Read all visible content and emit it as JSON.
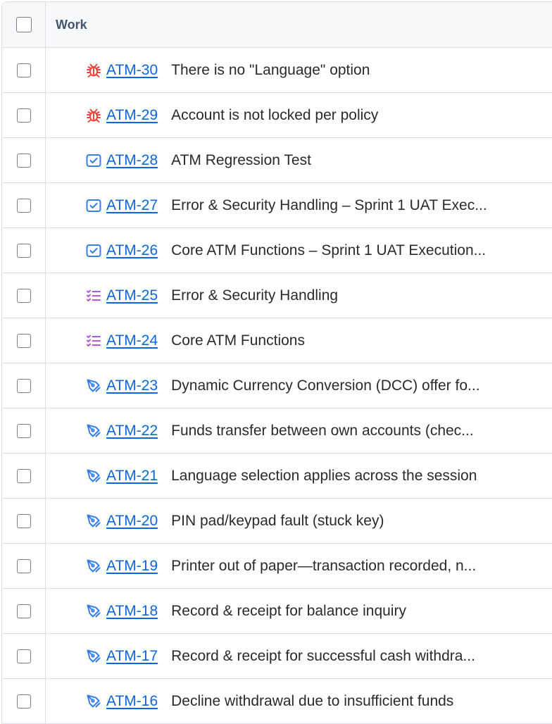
{
  "header": {
    "work_label": "Work"
  },
  "rows": [
    {
      "key": "ATM-30",
      "summary": "There is no \"Language\" option",
      "type": "bug",
      "icon": "bug-icon",
      "color": "#e2483d"
    },
    {
      "key": "ATM-29",
      "summary": "Account is not locked per policy",
      "type": "bug",
      "icon": "bug-icon",
      "color": "#e2483d"
    },
    {
      "key": "ATM-28",
      "summary": "ATM Regression Test",
      "type": "test-execution",
      "icon": "checkbox-icon",
      "color": "#357de8"
    },
    {
      "key": "ATM-27",
      "summary": "Error & Security Handling – Sprint 1 UAT Exec...",
      "type": "test-execution",
      "icon": "checkbox-icon",
      "color": "#357de8"
    },
    {
      "key": "ATM-26",
      "summary": "Core ATM Functions – Sprint 1 UAT Execution...",
      "type": "test-execution",
      "icon": "checkbox-icon",
      "color": "#357de8"
    },
    {
      "key": "ATM-25",
      "summary": "Error & Security Handling",
      "type": "test-plan",
      "icon": "checklist-icon",
      "color": "#af59e1"
    },
    {
      "key": "ATM-24",
      "summary": "Core ATM Functions",
      "type": "test-plan",
      "icon": "checklist-icon",
      "color": "#af59e1"
    },
    {
      "key": "ATM-23",
      "summary": "Dynamic Currency Conversion (DCC) offer fo...",
      "type": "test",
      "icon": "pen-tool-icon",
      "color": "#357de8"
    },
    {
      "key": "ATM-22",
      "summary": "Funds transfer between own accounts (chec...",
      "type": "test",
      "icon": "pen-tool-icon",
      "color": "#357de8"
    },
    {
      "key": "ATM-21",
      "summary": "Language selection applies across the session",
      "type": "test",
      "icon": "pen-tool-icon",
      "color": "#357de8"
    },
    {
      "key": "ATM-20",
      "summary": "PIN pad/keypad fault (stuck key)",
      "type": "test",
      "icon": "pen-tool-icon",
      "color": "#357de8"
    },
    {
      "key": "ATM-19",
      "summary": "Printer out of paper—transaction recorded, n...",
      "type": "test",
      "icon": "pen-tool-icon",
      "color": "#357de8"
    },
    {
      "key": "ATM-18",
      "summary": "Record & receipt for balance inquiry",
      "type": "test",
      "icon": "pen-tool-icon",
      "color": "#357de8"
    },
    {
      "key": "ATM-17",
      "summary": "Record & receipt for successful cash withdra...",
      "type": "test",
      "icon": "pen-tool-icon",
      "color": "#357de8"
    },
    {
      "key": "ATM-16",
      "summary": "Decline withdrawal due to insufficient funds",
      "type": "test",
      "icon": "pen-tool-icon",
      "color": "#357de8"
    }
  ]
}
